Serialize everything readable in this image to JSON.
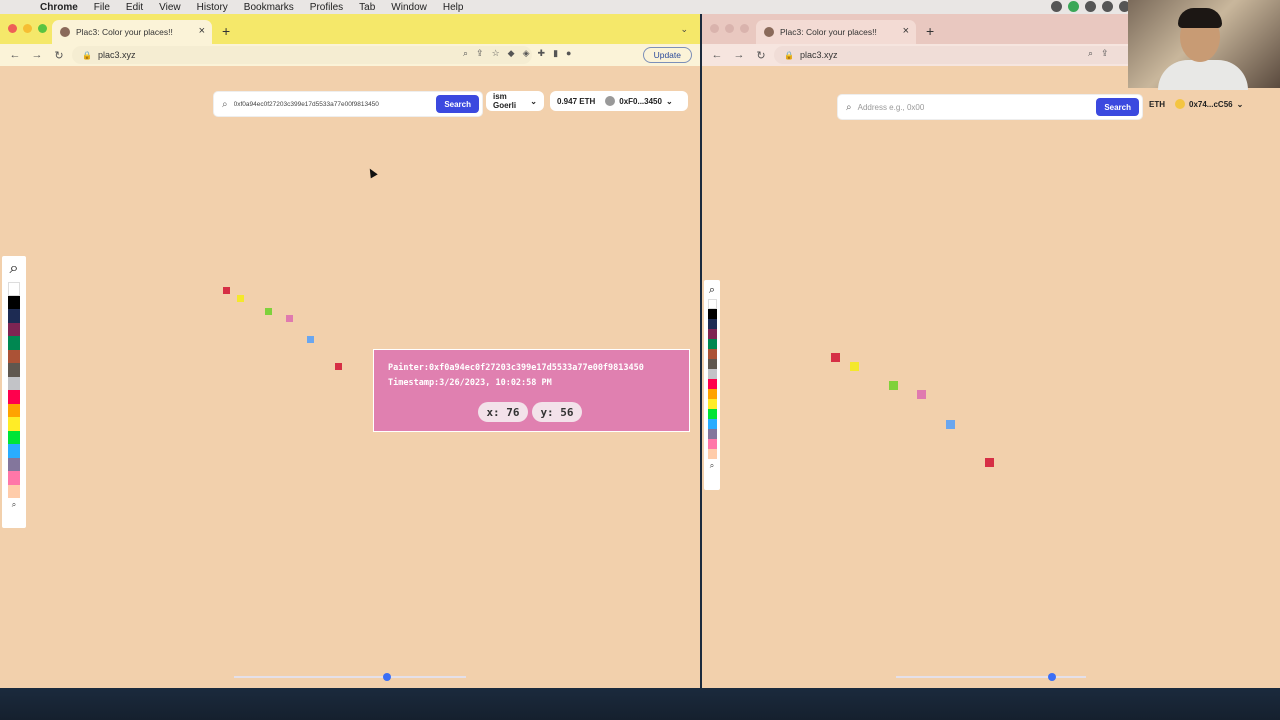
{
  "menubar": {
    "app": "Chrome",
    "items": [
      "File",
      "Edit",
      "View",
      "History",
      "Bookmarks",
      "Profiles",
      "Tab",
      "Window",
      "Help"
    ]
  },
  "left_window": {
    "tab_title": "Plac3: Color your places!!",
    "url": "plac3.xyz",
    "update_label": "Update",
    "search": {
      "value": "0xf0a94ec0f27203c399e17d5533a77e00f9813450",
      "button": "Search"
    },
    "network_label": "ism Goerli",
    "balance_label": "0.947 ETH",
    "account_label": "0xF0...3450",
    "tooltip": {
      "painter": "Painter:0xf0a94ec0f27203c399e17d5533a77e00f9813450",
      "timestamp": "Timestamp:3/26/2023, 10:02:58 PM",
      "x_label": "x: 76",
      "y_label": "y: 56"
    },
    "slider_value": 0.66
  },
  "right_window": {
    "tab_title": "Plac3: Color your places!!",
    "url": "plac3.xyz",
    "search": {
      "placeholder": "Address e.g., 0x00",
      "button": "Search"
    },
    "balance_label": "ETH",
    "account_label": "0x74...cC56",
    "slider_value": 0.82
  },
  "palette_colors": [
    "#ffffff",
    "#000000",
    "#1d2b53",
    "#7e2553",
    "#008751",
    "#ab5236",
    "#5f574f",
    "#c2c3c7",
    "#ff004d",
    "#ffa300",
    "#ffec27",
    "#00e436",
    "#29adff",
    "#83769c",
    "#ff77a8",
    "#ffccaa"
  ],
  "pixel_colors": [
    "#d62f45",
    "#f4e82b",
    "#7fd13b",
    "#e07aaf",
    "#6aa6ef",
    "#d62f45"
  ]
}
